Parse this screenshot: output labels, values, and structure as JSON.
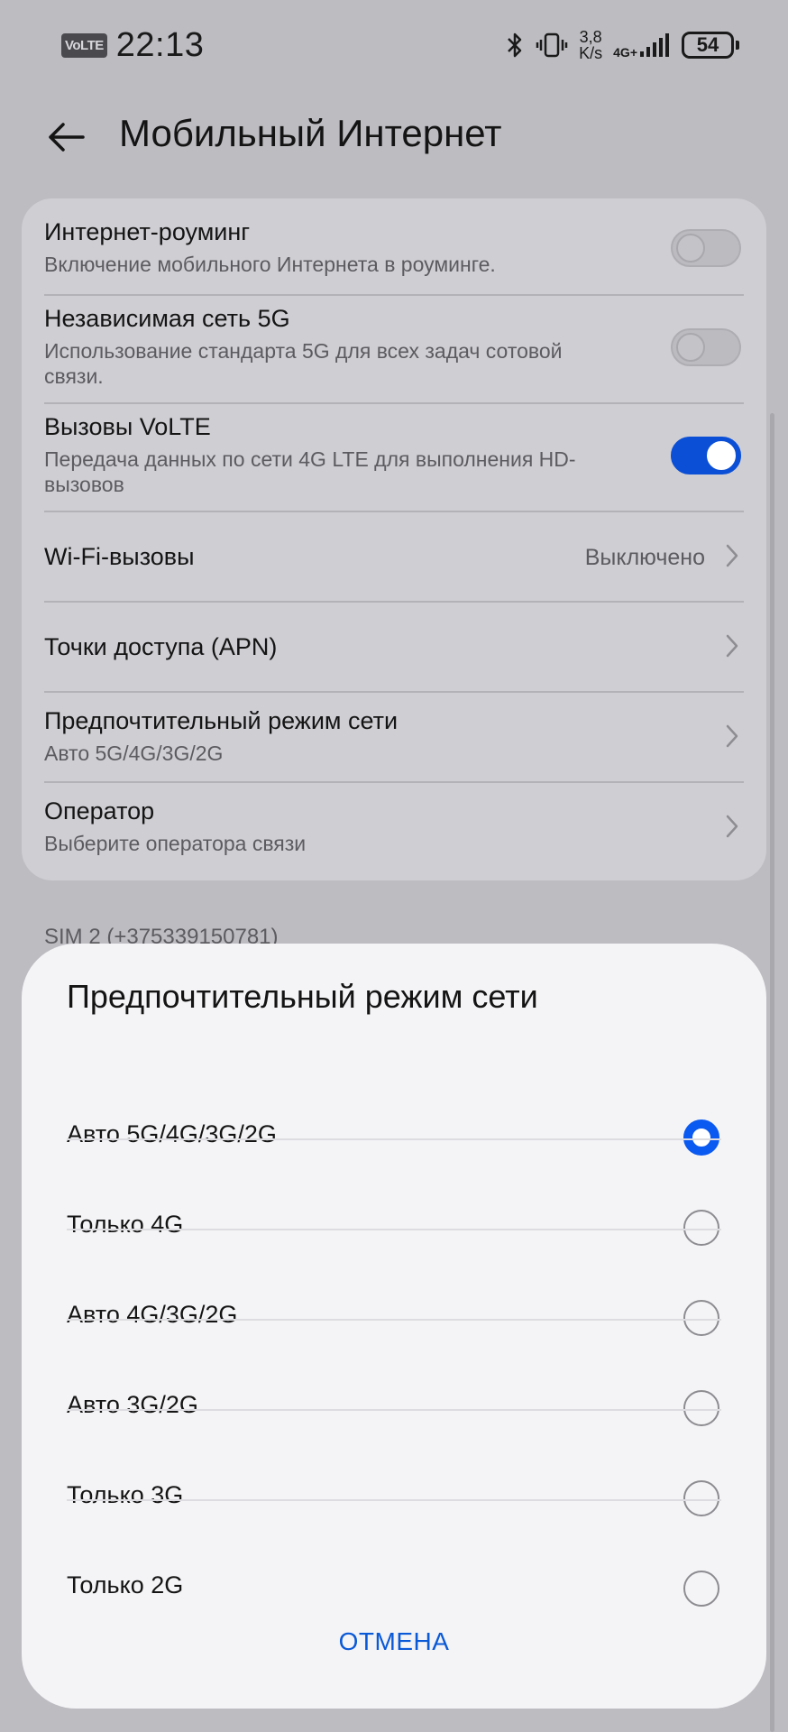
{
  "status_bar": {
    "volte": "VoLTE",
    "time": "22:13",
    "speed_value": "3,8",
    "speed_unit": "K/s",
    "network": "4G+",
    "battery": "54"
  },
  "header": {
    "title": "Мобильный Интернет"
  },
  "settings": {
    "items": [
      {
        "title": "Интернет-роуминг",
        "subtitle": "Включение мобильного Интернета в роуминге.",
        "toggle": false
      },
      {
        "title": "Независимая сеть 5G",
        "subtitle": "Использование стандарта 5G для всех задач сотовой связи.",
        "toggle": false
      },
      {
        "title": "Вызовы VoLTE",
        "subtitle": "Передача данных по сети 4G LTE для выполнения HD-вызовов",
        "toggle": true
      },
      {
        "title": "Wi-Fi-вызовы",
        "value": "Выключено"
      },
      {
        "title": "Точки доступа (APN)"
      },
      {
        "title": "Предпочтительный режим сети",
        "subtitle": "Авто 5G/4G/3G/2G"
      },
      {
        "title": "Оператор",
        "subtitle": "Выберите оператора связи"
      }
    ]
  },
  "sim2_label": "SIM 2 (+375339150781)",
  "dialog": {
    "title": "Предпочтительный режим сети",
    "options": [
      {
        "label": "Авто 5G/4G/3G/2G",
        "selected": true
      },
      {
        "label": "Только 4G",
        "selected": false
      },
      {
        "label": "Авто 4G/3G/2G",
        "selected": false
      },
      {
        "label": "Авто 3G/2G",
        "selected": false
      },
      {
        "label": "Только 3G",
        "selected": false
      },
      {
        "label": "Только 2G",
        "selected": false
      }
    ],
    "cancel_label": "ОТМЕНА"
  },
  "colors": {
    "accent": "#0a59f0",
    "background": "#bdbcc1",
    "dialog_background": "#f4f4f7"
  }
}
